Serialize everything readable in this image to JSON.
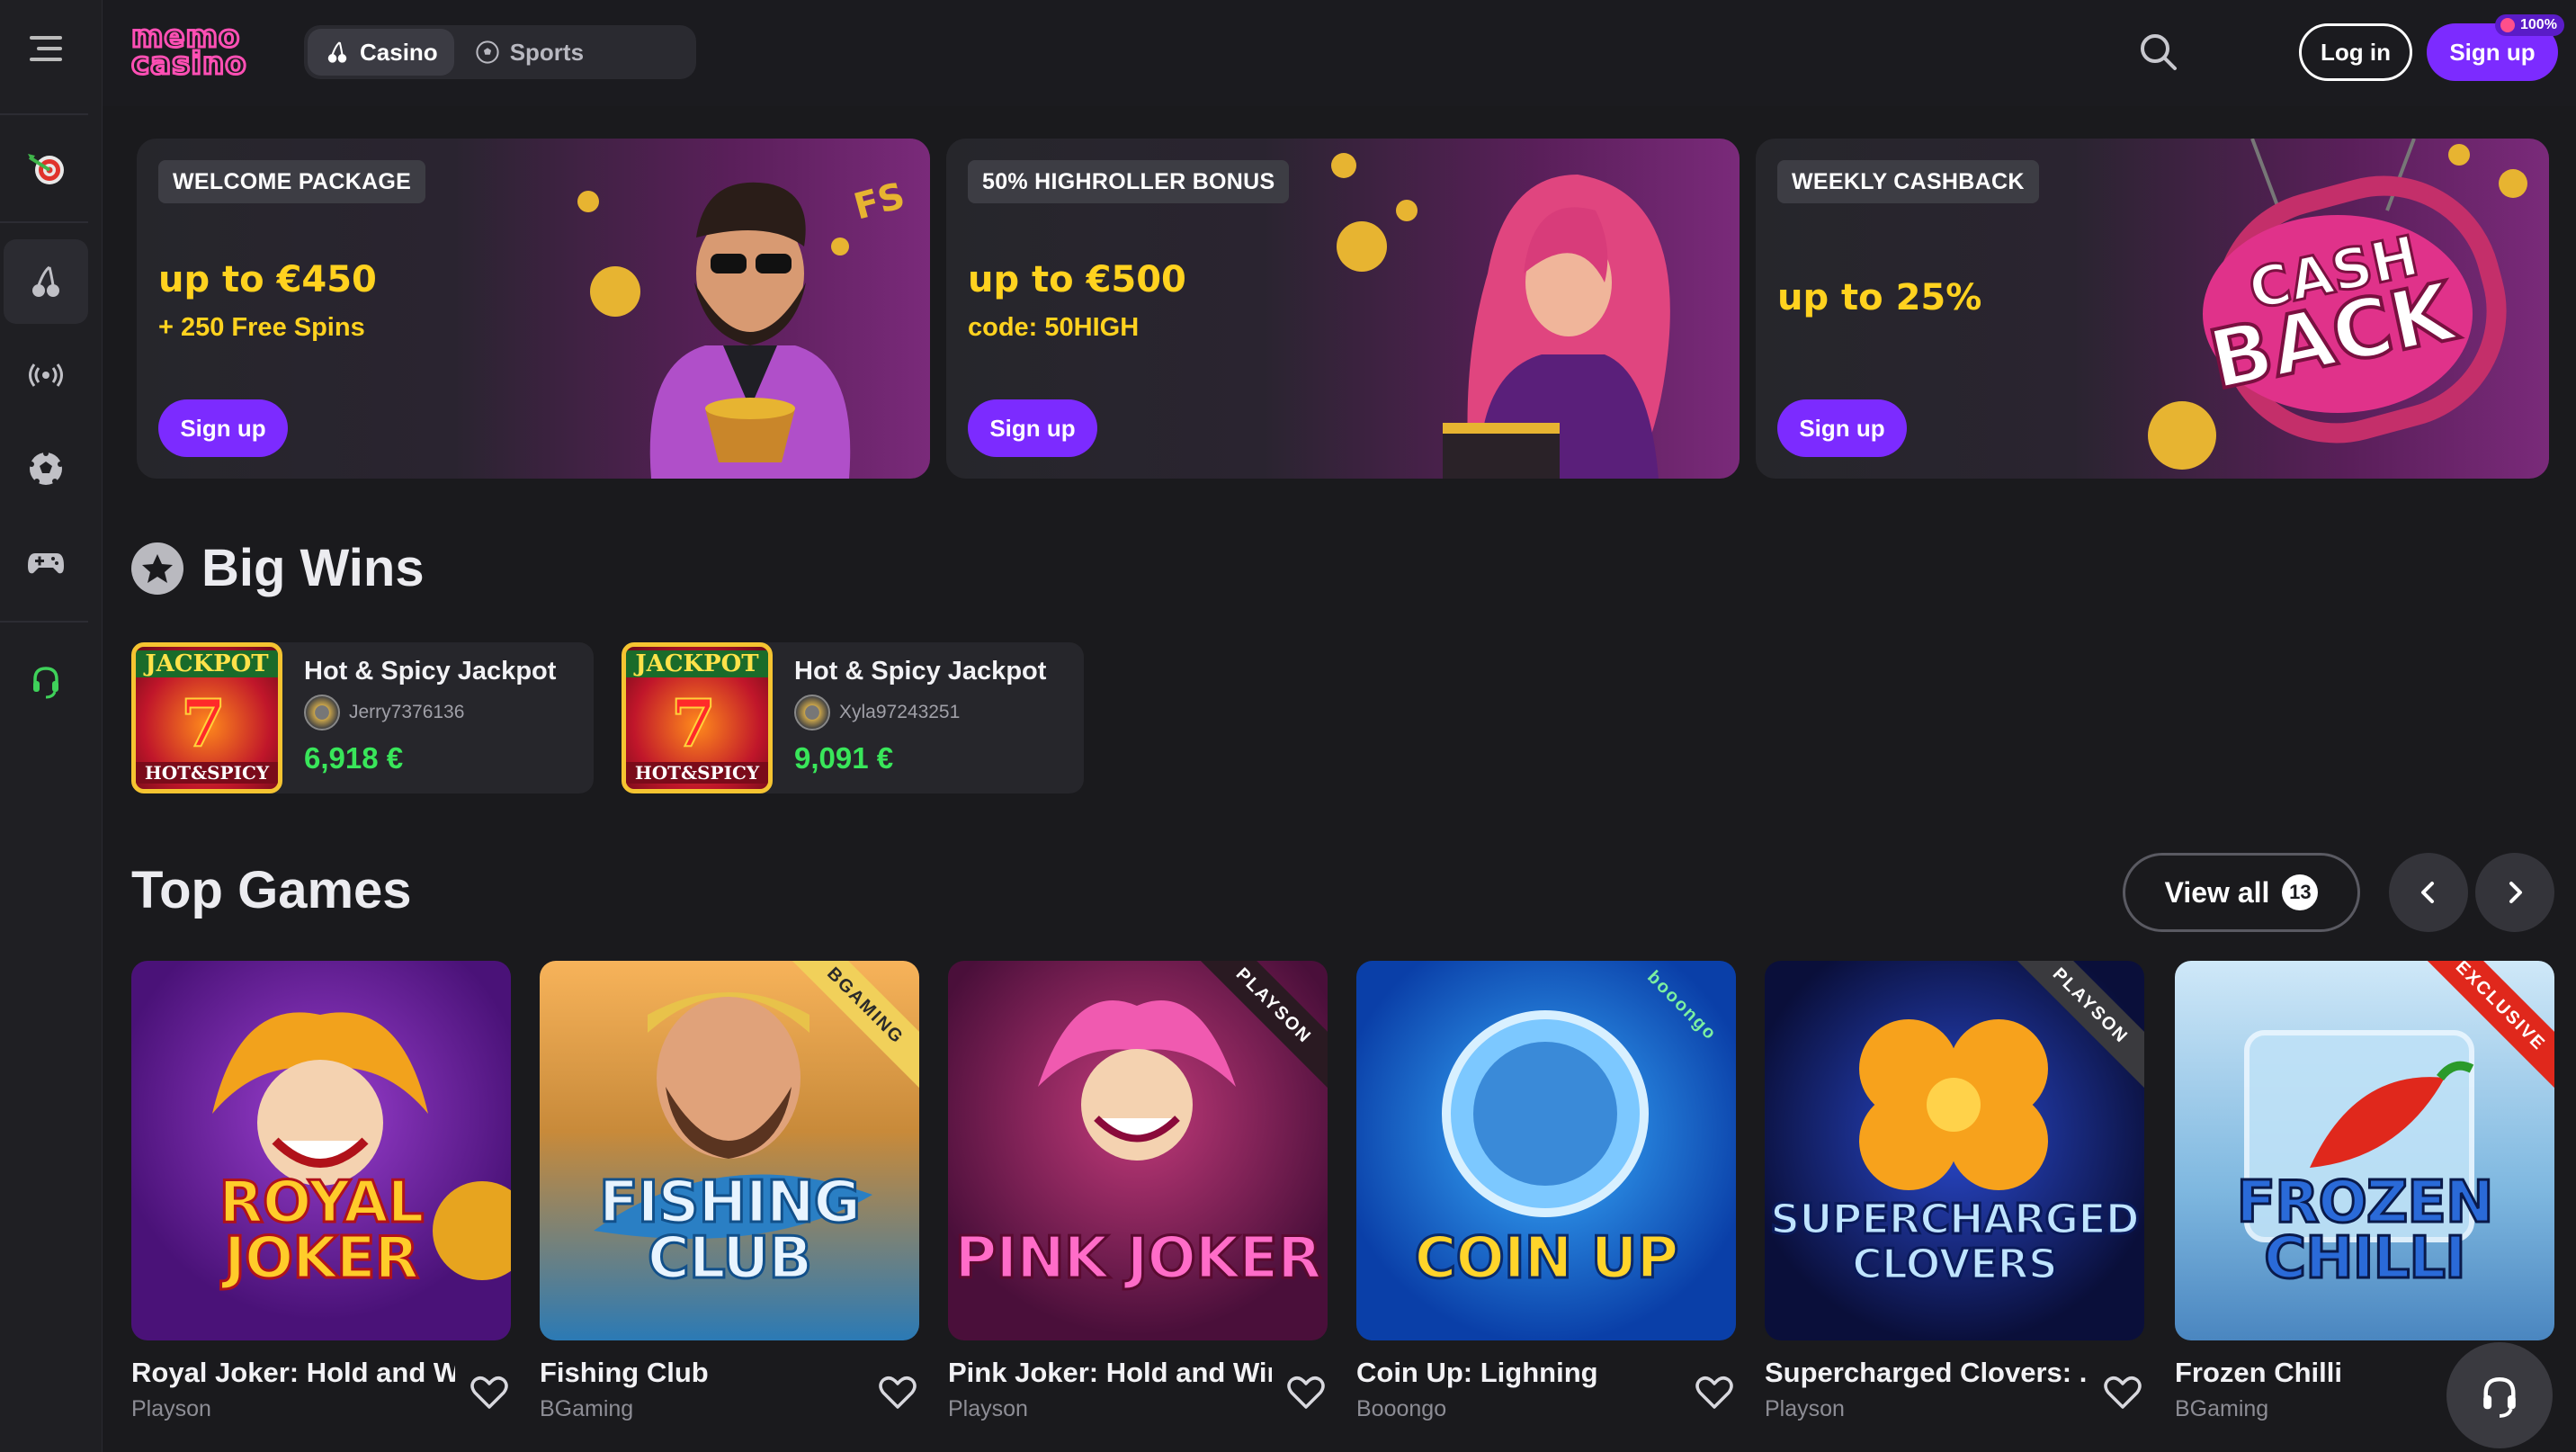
{
  "header": {
    "logo_line1": "memo",
    "logo_line2": "casino",
    "tabs": [
      {
        "label": "Casino",
        "active": true
      },
      {
        "label": "Sports",
        "active": false
      }
    ],
    "login_label": "Log in",
    "signup_label": "Sign up",
    "signup_badge": "100%"
  },
  "sidebar": {
    "items": [
      {
        "icon": "dart-target-icon",
        "active": false
      },
      {
        "icon": "cherries-icon",
        "active": true
      },
      {
        "icon": "live-broadcast-icon",
        "active": false
      },
      {
        "icon": "soccer-ball-icon",
        "active": false
      },
      {
        "icon": "gamepad-icon",
        "active": false
      },
      {
        "icon": "headset-icon",
        "active": false
      }
    ]
  },
  "promos": [
    {
      "tag": "WELCOME PACKAGE",
      "amount": "up to €450",
      "sub": "+ 250 Free Spins",
      "cta": "Sign up"
    },
    {
      "tag": "50% HIGHROLLER BONUS",
      "amount": "up to €500",
      "sub": "code: 50HIGH",
      "cta": "Sign up"
    },
    {
      "tag": "WEEKLY CASHBACK",
      "amount": "up to 25%",
      "sub": "",
      "cta": "Sign up",
      "art_text_1": "CASH",
      "art_text_2": "BACK"
    }
  ],
  "big_wins": {
    "title": "Big Wins",
    "items": [
      {
        "game": "Hot & Spicy Jackpot",
        "user": "Jerry7376136",
        "amount": "6,918 €",
        "thumb_top": "JACKPOT",
        "thumb_bottom": "HOT&SPICY"
      },
      {
        "game": "Hot & Spicy Jackpot",
        "user": "Xyla97243251",
        "amount": "9,091 €",
        "thumb_top": "JACKPOT",
        "thumb_bottom": "HOT&SPICY"
      }
    ]
  },
  "top_games": {
    "title": "Top Games",
    "view_all": "View all",
    "count": "13",
    "games": [
      {
        "name": "Royal Joker: Hold and W...",
        "provider": "Playson",
        "art": "ROYAL JOKER",
        "badge": ""
      },
      {
        "name": "Fishing Club",
        "provider": "BGaming",
        "art": "FISHING CLUB",
        "badge": "BGAMING"
      },
      {
        "name": "Pink Joker: Hold and Win",
        "provider": "Playson",
        "art": "PINK JOKER",
        "badge": "PLAYSON"
      },
      {
        "name": "Coin Up: Lighning",
        "provider": "Booongo",
        "art": "COIN UP",
        "badge": "booongo"
      },
      {
        "name": "Supercharged Clovers: ...",
        "provider": "Playson",
        "art": "SUPERCHARGED CLOVERS",
        "badge": "PLAYSON"
      },
      {
        "name": "Frozen Chilli",
        "provider": "BGaming",
        "art": "FROZEN CHILLI",
        "badge": "EXCLUSIVE"
      }
    ]
  },
  "colors": {
    "accent": "#7c2bff",
    "win_green": "#39e65a",
    "promo_yellow": "#ffd21f",
    "background": "#1a1a1d"
  }
}
